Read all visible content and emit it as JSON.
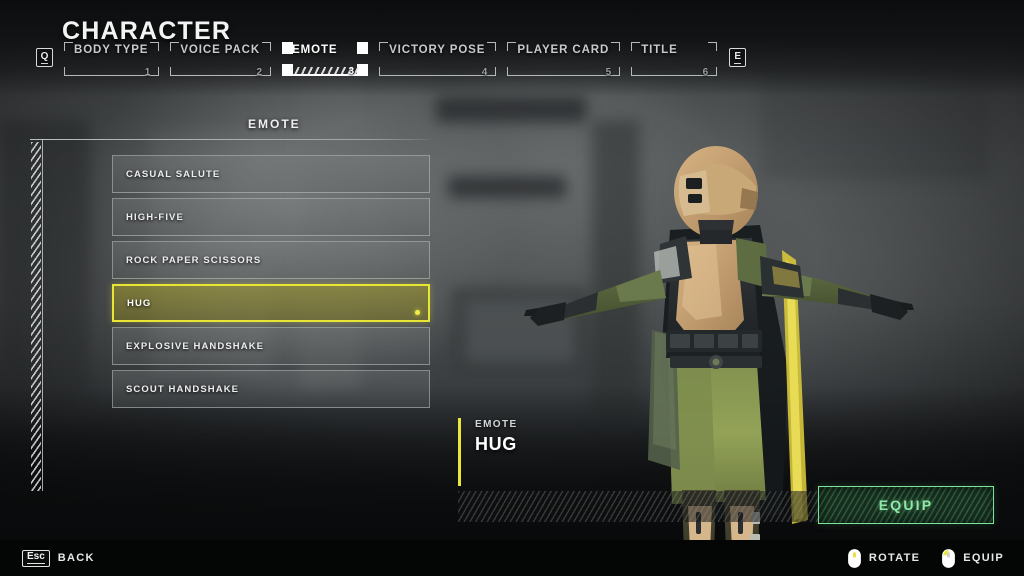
{
  "header": {
    "title": "CHARACTER",
    "prev_key": "Q",
    "next_key": "E",
    "tabs": [
      {
        "label": "BODY TYPE",
        "number": "1",
        "active": false
      },
      {
        "label": "VOICE PACK",
        "number": "2",
        "active": false
      },
      {
        "label": "EMOTE",
        "number": "3",
        "active": true
      },
      {
        "label": "VICTORY POSE",
        "number": "4",
        "active": false
      },
      {
        "label": "PLAYER CARD",
        "number": "5",
        "active": false
      },
      {
        "label": "TITLE",
        "number": "6",
        "active": false
      }
    ]
  },
  "main": {
    "section_title": "EMOTE",
    "emotes": [
      {
        "label": "CASUAL SALUTE",
        "selected": false
      },
      {
        "label": "HIGH-FIVE",
        "selected": false
      },
      {
        "label": "ROCK PAPER SCISSORS",
        "selected": false
      },
      {
        "label": "HUG",
        "selected": true
      },
      {
        "label": "EXPLOSIVE HANDSHAKE",
        "selected": false
      },
      {
        "label": "SCOUT HANDSHAKE",
        "selected": false
      }
    ]
  },
  "detail": {
    "kind": "EMOTE",
    "name": "HUG",
    "equip_label": "EQUIP"
  },
  "statusbar": {
    "back_key": "Esc",
    "back_label": "BACK",
    "rotate_label": "ROTATE",
    "equip_label": "EQUIP"
  },
  "colors": {
    "accent_yellow": "#eae63a",
    "equip_green": "#8fe9a8",
    "text_primary": "#ffffff",
    "text_muted": "#c7cacb",
    "panel_border": "#c4c7c8"
  }
}
